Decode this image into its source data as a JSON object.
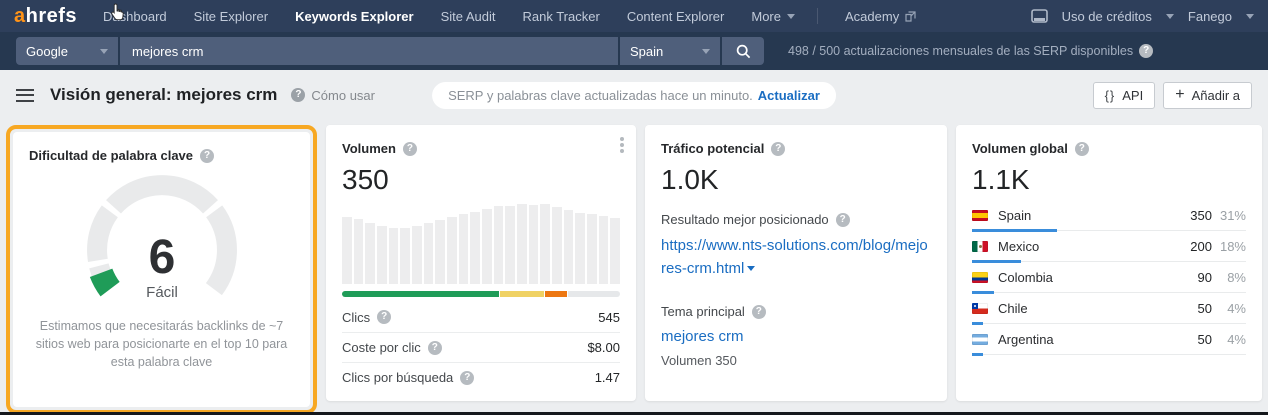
{
  "colors": {
    "accent_orange": "#f7a823",
    "kd_green": "#1f9c58",
    "stack_green": "#1f9c58",
    "stack_yellow": "#f0d264",
    "stack_orange": "#ed7712",
    "link_blue": "#1a6dc2",
    "country_bar_blue": "#3a8ddb",
    "navbar_bg": "#2e3f5b"
  },
  "navbar": {
    "logo_a": "a",
    "logo_rest": "hrefs",
    "items": [
      {
        "label": "Dashboard"
      },
      {
        "label": "Site Explorer"
      },
      {
        "label": "Keywords Explorer",
        "cls": "active"
      },
      {
        "label": "Site Audit"
      },
      {
        "label": "Rank Tracker"
      },
      {
        "label": "Content Explorer"
      }
    ],
    "more_label": "More",
    "academy_label": "Academy",
    "credits_label": "Uso de créditos",
    "user_label": "Fanego"
  },
  "search": {
    "engine": "Google",
    "query": "mejores crm",
    "country": "Spain",
    "credits_info": "498 / 500 actualizaciones mensuales de las SERP disponibles"
  },
  "header": {
    "title": "Visión general: mejores crm",
    "howto_label": "Cómo usar",
    "serp_status": "SERP y palabras clave actualizadas hace un minuto.",
    "refresh_label": "Actualizar",
    "api_label": "API",
    "add_label": "Añadir a"
  },
  "kd_card": {
    "title": "Dificultad de palabra clave",
    "score": "6",
    "level": "Fácil",
    "description": "Estimamos que necesitarás backlinks de ~7 sitios web para posicionarte en el top 10 para esta palabra clave"
  },
  "volumen": {
    "title": "Volumen",
    "value": "350",
    "bars": [
      0.84,
      0.81,
      0.76,
      0.73,
      0.7,
      0.7,
      0.73,
      0.76,
      0.8,
      0.84,
      0.87,
      0.9,
      0.94,
      0.97,
      0.98,
      1.0,
      0.99,
      1.0,
      0.96,
      0.93,
      0.89,
      0.87,
      0.85,
      0.83
    ],
    "stacked_segments": [
      {
        "color": "#1f9c58",
        "pct": 57
      },
      {
        "color": "#f0d264",
        "pct": 16
      },
      {
        "color": "#ed7712",
        "pct": 8
      },
      {
        "color": "#e6e8ea",
        "pct": 19
      }
    ],
    "rows": [
      {
        "label": "Clics",
        "value": "545"
      },
      {
        "label": "Coste por clic",
        "value": "$8.00"
      },
      {
        "label": "Clics por búsqueda",
        "value": "1.47"
      }
    ]
  },
  "trafico": {
    "title": "Tráfico potencial",
    "value": "1.0K",
    "top_result_label": "Resultado mejor posicionado",
    "url": "https://www.nts-solutions.com/blog/mejores-crm.html",
    "topic_label": "Tema principal",
    "topic": "mejores crm",
    "volume_note": "Volumen 350"
  },
  "volumen_global": {
    "title": "Volumen global",
    "value": "1.1K",
    "countries": [
      {
        "flag": "flag-es",
        "name": "Spain",
        "value": "350",
        "pct": "31%",
        "bar": 31
      },
      {
        "flag": "flag-mx",
        "name": "Mexico",
        "value": "200",
        "pct": "18%",
        "bar": 18
      },
      {
        "flag": "flag-co",
        "name": "Colombia",
        "value": "90",
        "pct": "8%",
        "bar": 8
      },
      {
        "flag": "flag-cl",
        "name": "Chile",
        "value": "50",
        "pct": "4%",
        "bar": 4
      },
      {
        "flag": "flag-ar",
        "name": "Argentina",
        "value": "50",
        "pct": "4%",
        "bar": 4
      }
    ]
  }
}
